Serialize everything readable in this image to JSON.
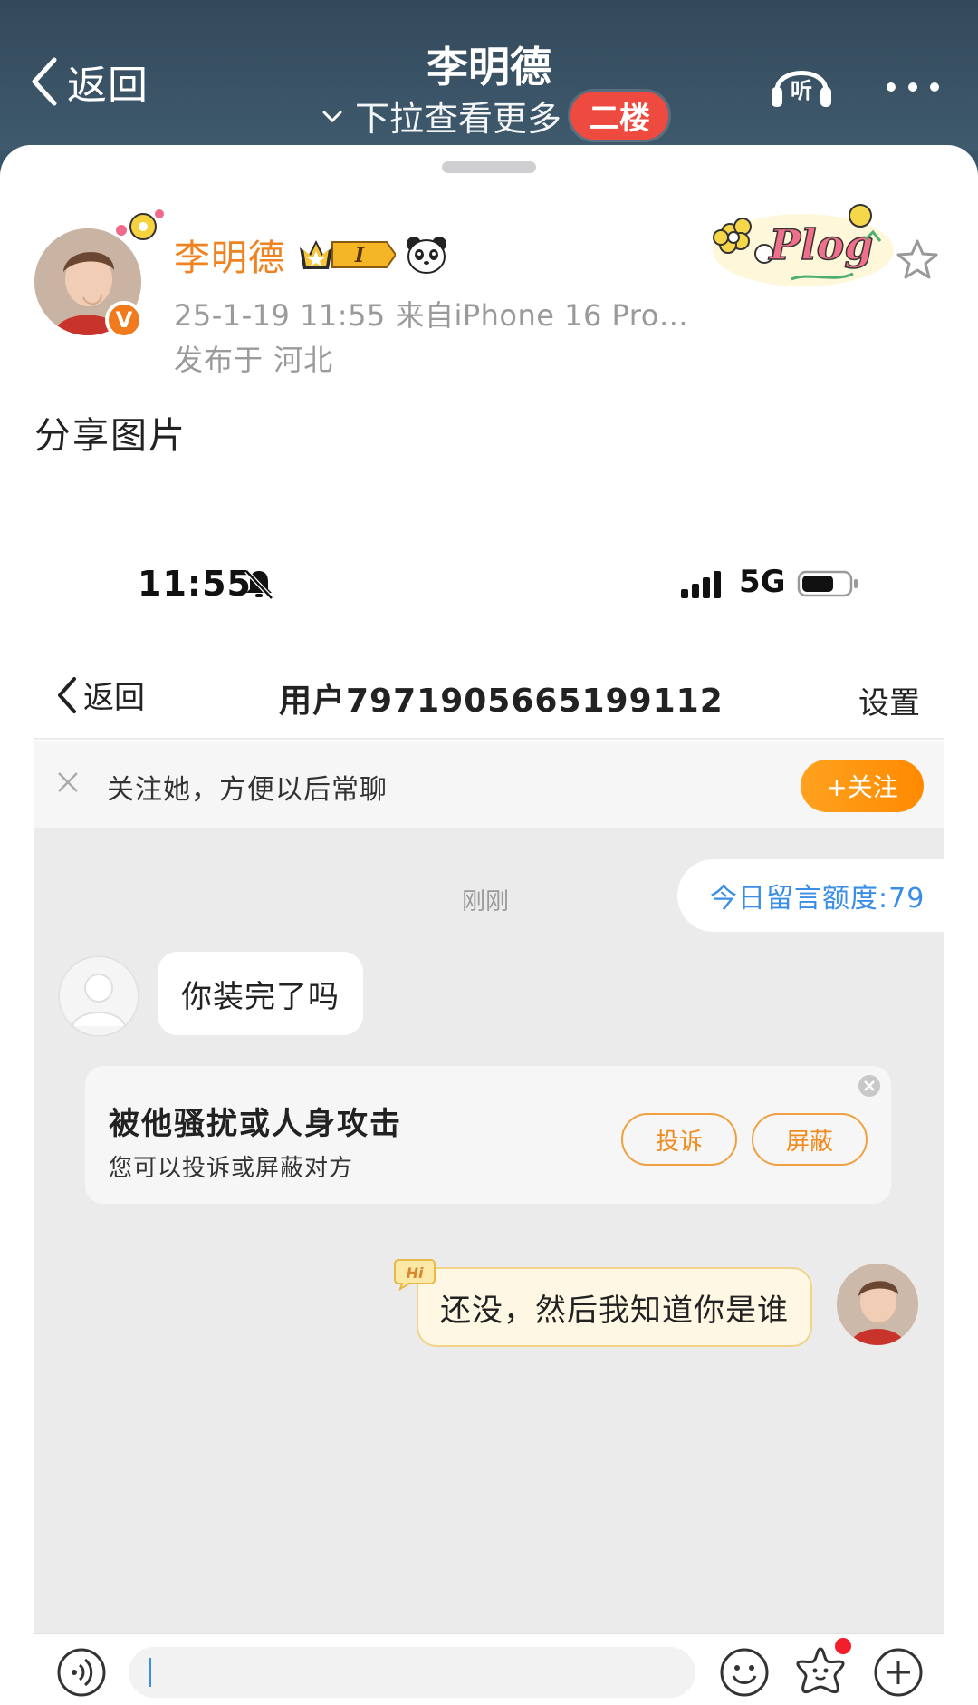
{
  "header": {
    "back_label": "返回",
    "title": "李明德",
    "subtitle": "下拉查看更多",
    "floor_badge": "二楼",
    "listen_label": "听"
  },
  "post": {
    "author": "李明德",
    "member_badge": "I",
    "time_source": "25-1-19 11:55  来自iPhone 16 Pro…",
    "location": "发布于 河北",
    "text": "分享图片",
    "verified_badge": "V",
    "decor_text": "Plog"
  },
  "screenshot": {
    "status": {
      "time": "11:55",
      "network": "5G"
    },
    "nav": {
      "back_label": "返回",
      "title": "用户7971905665199112",
      "settings_label": "设置"
    },
    "follow_bar": {
      "text": "关注她，方便以后常聊",
      "button": "+关注"
    },
    "chat": {
      "quota": "今日留言额度:79",
      "timestamp": "刚刚",
      "incoming_message": "你装完了吗",
      "warning": {
        "title": "被他骚扰或人身攻击",
        "subtitle": "您可以投诉或屏蔽对方",
        "report_button": "投诉",
        "block_button": "屏蔽"
      },
      "outgoing_message": "还没，然后我知道你是谁",
      "hi_tag": "Hi"
    }
  },
  "colors": {
    "header_bg": "#3a5467",
    "author_orange": "#f0821f",
    "floor_badge_red": "#ee4a3f",
    "follow_button_orange": "#ff9a12",
    "quota_blue": "#3a8ee6",
    "chat_bg": "#ebebeb"
  },
  "icons": [
    "chevron-left-icon",
    "chevron-down-icon",
    "headphones-icon",
    "more-dots-icon",
    "star-outline-icon",
    "bell-mute-icon",
    "signal-icon",
    "battery-icon",
    "close-icon",
    "voice-icon",
    "emoji-icon",
    "sticker-icon",
    "plus-icon"
  ]
}
